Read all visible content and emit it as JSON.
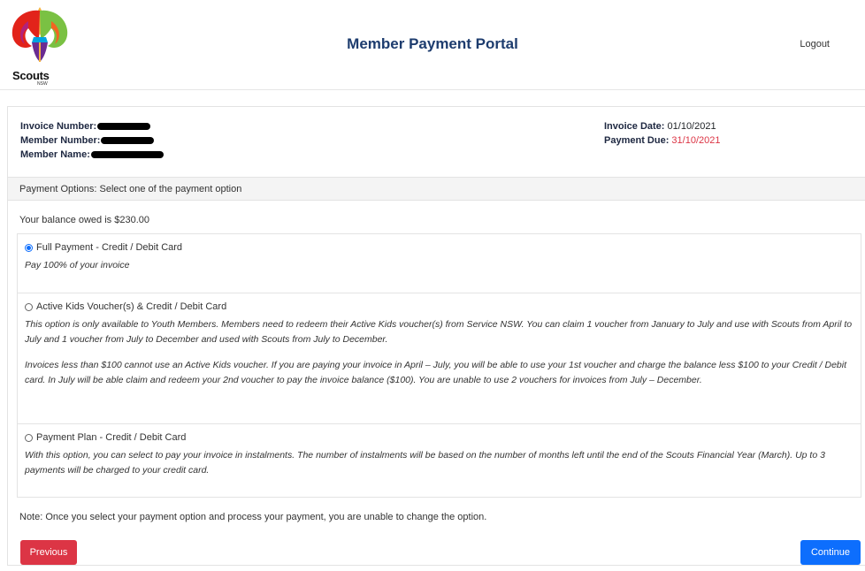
{
  "header": {
    "logo_text": "Scouts",
    "logo_sub": "NSW",
    "title": "Member Payment Portal",
    "logout_label": "Logout"
  },
  "invoice": {
    "number_label": "Invoice Number:",
    "member_number_label": "Member Number:",
    "member_name_label": "Member Name:",
    "date_label": "Invoice Date:",
    "date_value": "01/10/2021",
    "due_label": "Payment Due:",
    "due_value": "31/10/2021"
  },
  "payment_options": {
    "header": "Payment Options: Select one of the payment option",
    "balance": "Your balance owed is $230.00",
    "options": [
      {
        "label": "Full Payment - Credit / Debit Card",
        "selected": true,
        "desc": [
          "Pay 100% of your invoice"
        ]
      },
      {
        "label": "Active Kids Voucher(s) & Credit / Debit Card",
        "selected": false,
        "desc": [
          "This option is only available to Youth Members. Members need to redeem their Active Kids voucher(s) from Service NSW. You can claim 1 voucher from January to July and use with Scouts from April to July and 1 voucher from July to December and used with Scouts from July to December.",
          "Invoices less than $100 cannot use an Active Kids voucher. If you are paying your invoice in April – July, you will be able to use your 1st voucher and charge the balance less $100 to your Credit / Debit card. In July will be able claim and redeem your 2nd voucher to pay the invoice balance ($100). You are unable to use 2 vouchers for invoices from July – December."
        ]
      },
      {
        "label": "Payment Plan - Credit / Debit Card",
        "selected": false,
        "desc": [
          "With this option, you can select to pay your invoice in instalments. The number of instalments will be based on the number of months left until the end of the Scouts Financial Year (March). Up to 3 payments will be charged to your credit card."
        ]
      }
    ],
    "note": "Note: Once you select your payment option and process your payment, you are unable to change the option."
  },
  "buttons": {
    "previous": "Previous",
    "continue": "Continue"
  },
  "colors": {
    "title": "#1d3c6e",
    "danger": "#dc3545",
    "primary": "#0d6efd"
  }
}
